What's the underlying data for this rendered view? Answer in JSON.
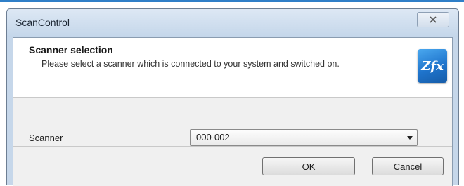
{
  "window": {
    "title": "ScanControl",
    "close_icon": "close-x-icon"
  },
  "header": {
    "title": "Scanner selection",
    "description": "Please select a scanner which is connected to your system and switched on.",
    "logo_text": "Zfx",
    "logo_color": "#1f74cc"
  },
  "form": {
    "scanner_label": "Scanner",
    "scanner_value": "000-002"
  },
  "buttons": {
    "ok_label": "OK",
    "cancel_label": "Cancel"
  }
}
